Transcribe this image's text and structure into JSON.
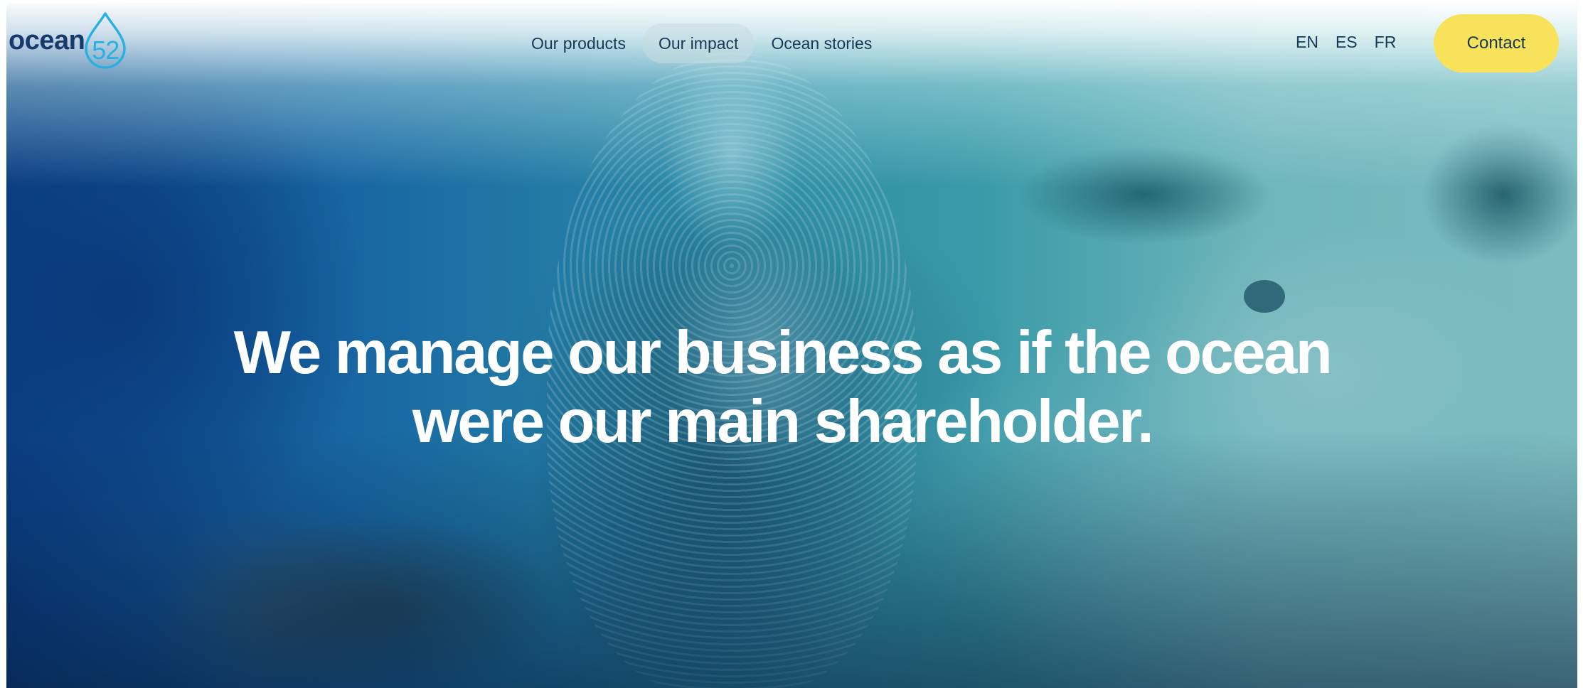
{
  "logo": {
    "word": "ocean",
    "number": "52"
  },
  "nav": {
    "items": [
      {
        "label": "Our products"
      },
      {
        "label": "Our impact"
      },
      {
        "label": "Ocean stories"
      }
    ]
  },
  "languages": [
    "EN",
    "ES",
    "FR"
  ],
  "contact_label": "Contact",
  "hero": {
    "headline_line1": "We manage our business as if the ocean",
    "headline_line2": "were our main shareholder."
  },
  "colors": {
    "brand_navy": "#163a6b",
    "brand_cyan": "#2ab0e0",
    "contact_yellow": "#f8e15b",
    "headline_white": "#ffffff"
  }
}
